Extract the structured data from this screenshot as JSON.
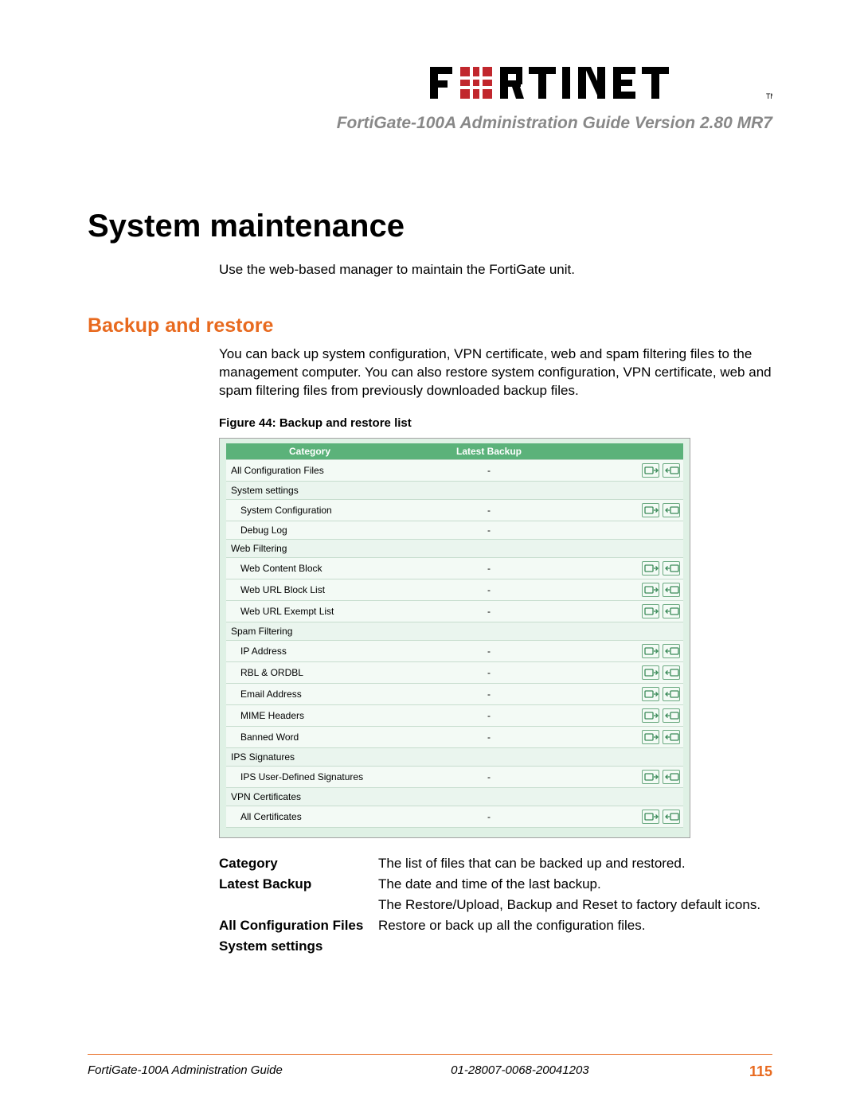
{
  "header": {
    "brand": "FORTINET",
    "subtitle": "FortiGate-100A Administration Guide Version 2.80 MR7"
  },
  "chapter": {
    "title": "System maintenance",
    "intro": "Use the web-based manager to maintain the FortiGate unit."
  },
  "section": {
    "title": "Backup and restore",
    "body": "You can back up system configuration, VPN certificate, web and spam filtering files to the management computer. You can also restore system configuration, VPN certificate, web and spam filtering files from previously downloaded backup files."
  },
  "figure": {
    "caption": "Figure 44: Backup and restore list",
    "columns": {
      "category": "Category",
      "latest": "Latest Backup"
    },
    "rows": [
      {
        "type": "item",
        "indent": 0,
        "label": "All Configuration Files",
        "latest": "-",
        "actions": [
          "backup",
          "restore"
        ]
      },
      {
        "type": "group",
        "indent": 0,
        "label": "System settings"
      },
      {
        "type": "item",
        "indent": 1,
        "label": "System Configuration",
        "latest": "-",
        "actions": [
          "backup",
          "restore"
        ]
      },
      {
        "type": "item",
        "indent": 1,
        "label": "Debug Log",
        "latest": "-",
        "actions": []
      },
      {
        "type": "group",
        "indent": 0,
        "label": "Web Filtering"
      },
      {
        "type": "item",
        "indent": 1,
        "label": "Web Content Block",
        "latest": "-",
        "actions": [
          "backup",
          "restore"
        ]
      },
      {
        "type": "item",
        "indent": 1,
        "label": "Web URL Block List",
        "latest": "-",
        "actions": [
          "backup",
          "restore"
        ]
      },
      {
        "type": "item",
        "indent": 1,
        "label": "Web URL Exempt List",
        "latest": "-",
        "actions": [
          "backup",
          "restore"
        ]
      },
      {
        "type": "group",
        "indent": 0,
        "label": "Spam Filtering"
      },
      {
        "type": "item",
        "indent": 1,
        "label": "IP Address",
        "latest": "-",
        "actions": [
          "backup",
          "restore"
        ]
      },
      {
        "type": "item",
        "indent": 1,
        "label": "RBL & ORDBL",
        "latest": "-",
        "actions": [
          "backup",
          "restore"
        ]
      },
      {
        "type": "item",
        "indent": 1,
        "label": "Email Address",
        "latest": "-",
        "actions": [
          "backup",
          "restore"
        ]
      },
      {
        "type": "item",
        "indent": 1,
        "label": "MIME Headers",
        "latest": "-",
        "actions": [
          "backup",
          "restore"
        ]
      },
      {
        "type": "item",
        "indent": 1,
        "label": "Banned Word",
        "latest": "-",
        "actions": [
          "backup",
          "restore"
        ]
      },
      {
        "type": "group",
        "indent": 0,
        "label": "IPS Signatures"
      },
      {
        "type": "item",
        "indent": 1,
        "label": "IPS User-Defined Signatures",
        "latest": "-",
        "actions": [
          "backup",
          "restore"
        ]
      },
      {
        "type": "group",
        "indent": 0,
        "label": "VPN Certificates"
      },
      {
        "type": "item",
        "indent": 1,
        "label": "All Certificates",
        "latest": "-",
        "actions": [
          "backup",
          "restore"
        ]
      }
    ]
  },
  "definitions": [
    {
      "term": "Category",
      "desc": "The list of files that can be backed up and restored."
    },
    {
      "term": "Latest Backup",
      "desc": "The date and time of the last backup."
    },
    {
      "term": "",
      "desc": "The Restore/Upload, Backup and Reset to factory default icons."
    },
    {
      "term": "All Configuration Files",
      "desc": "Restore or back up all the configuration files."
    },
    {
      "term": "System settings",
      "desc": ""
    }
  ],
  "footer": {
    "left": "FortiGate-100A Administration Guide",
    "mid": "01-28007-0068-20041203",
    "page": "115"
  },
  "colors": {
    "accent": "#e86a1f",
    "tableHeader": "#5bb27a"
  }
}
